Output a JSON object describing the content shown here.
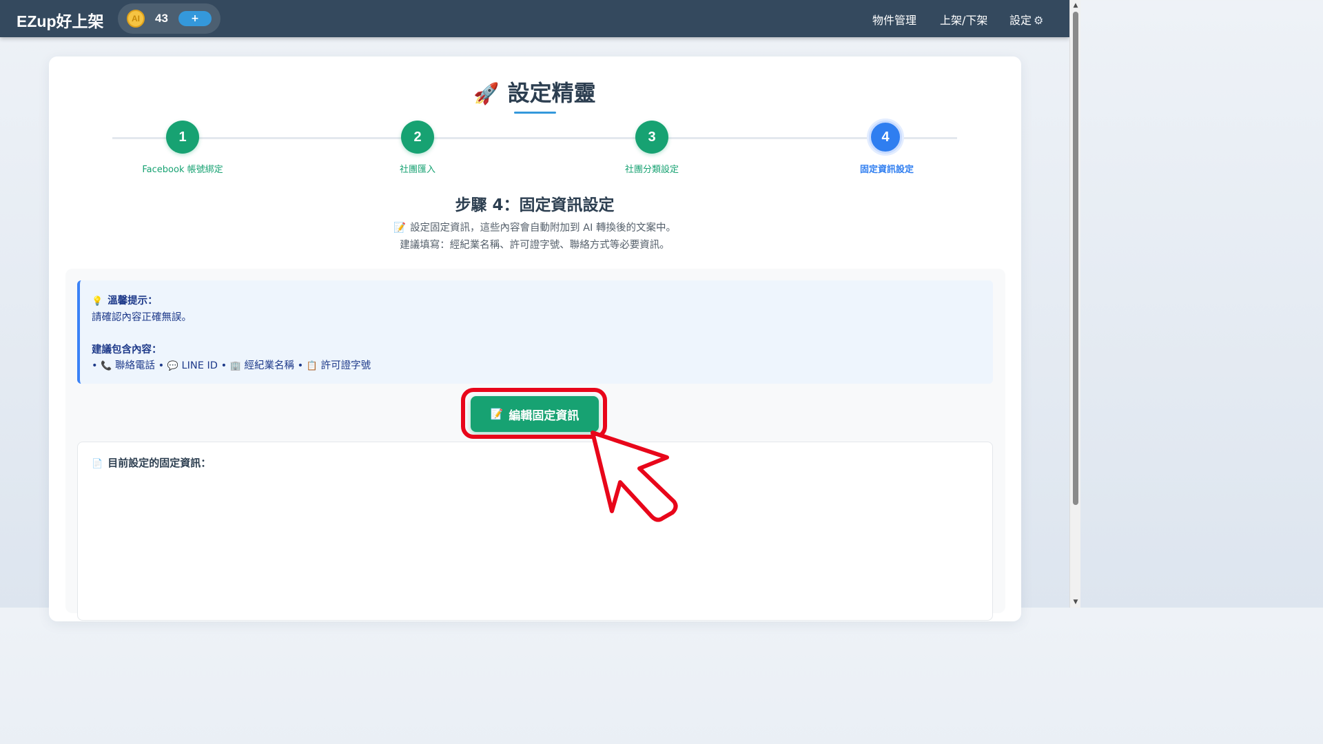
{
  "header": {
    "brand": "EZup好上架",
    "ai_badge": "AI",
    "ai_count": "43",
    "add_label": "+",
    "nav": [
      {
        "label": "物件管理"
      },
      {
        "label": "上架/下架"
      },
      {
        "label": "設定"
      }
    ]
  },
  "wizard": {
    "title": "設定精靈",
    "title_icon": "🚀",
    "steps": [
      {
        "number": "1",
        "label": "Facebook 帳號綁定",
        "status": "done"
      },
      {
        "number": "2",
        "label": "社團匯入",
        "status": "done"
      },
      {
        "number": "3",
        "label": "社團分類設定",
        "status": "done"
      },
      {
        "number": "4",
        "label": "固定資訊設定",
        "status": "active"
      }
    ],
    "step_heading": "步驟 4：固定資訊設定",
    "description_line1": "設定固定資訊，這些內容會自動附加到 AI 轉換後的文案中。",
    "description_line2": "建議填寫：經紀業名稱、許可證字號、聯絡方式等必要資訊。"
  },
  "tip": {
    "heading": "溫馨提示：",
    "text": "請確認內容正確無誤。",
    "suggest_heading": "建議包含內容：",
    "items": [
      {
        "icon": "📞",
        "label": "聯絡電話"
      },
      {
        "icon": "💬",
        "label": "LINE ID"
      },
      {
        "icon": "🏢",
        "label": "經紀業名稱"
      },
      {
        "icon": "📋",
        "label": "許可證字號"
      }
    ]
  },
  "edit_button": {
    "label": "編輯固定資訊"
  },
  "current_info": {
    "title": "目前設定的固定資訊："
  },
  "colors": {
    "header_bg": "#34495e",
    "step_done": "#17a272",
    "step_active": "#2f7ef0",
    "highlight": "#e8061a"
  }
}
